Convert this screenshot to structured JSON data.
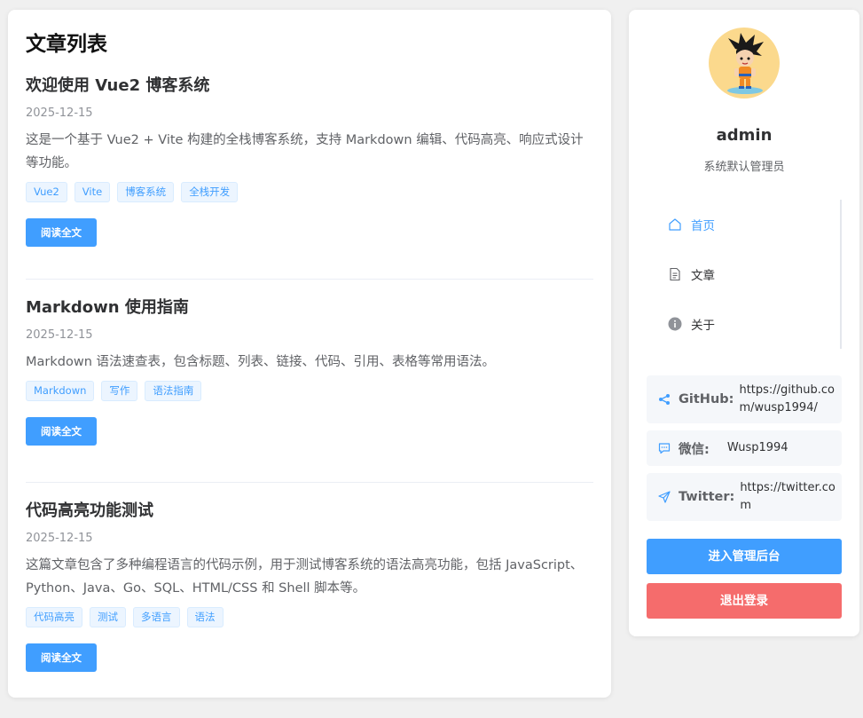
{
  "list": {
    "title": "文章列表",
    "read_more_label": "阅读全文",
    "articles": [
      {
        "title": "欢迎使用 Vue2 博客系统",
        "date": "2025-12-15",
        "summary": "这是一个基于 Vue2 + Vite 构建的全栈博客系统，支持 Markdown 编辑、代码高亮、响应式设计等功能。",
        "tags": [
          "Vue2",
          "Vite",
          "博客系统",
          "全栈开发"
        ]
      },
      {
        "title": "Markdown 使用指南",
        "date": "2025-12-15",
        "summary": "Markdown 语法速查表，包含标题、列表、链接、代码、引用、表格等常用语法。",
        "tags": [
          "Markdown",
          "写作",
          "语法指南"
        ]
      },
      {
        "title": "代码高亮功能测试",
        "date": "2025-12-15",
        "summary": "这篇文章包含了多种编程语言的代码示例，用于测试博客系统的语法高亮功能，包括 JavaScript、Python、Java、Go、SQL、HTML/CSS 和 Shell 脚本等。",
        "tags": [
          "代码高亮",
          "测试",
          "多语言",
          "语法"
        ]
      }
    ]
  },
  "sidebar": {
    "username": "admin",
    "description": "系统默认管理员",
    "nav": [
      {
        "label": "首页",
        "icon": "home-icon",
        "active": true
      },
      {
        "label": "文章",
        "icon": "document-icon",
        "active": false
      },
      {
        "label": "关于",
        "icon": "info-icon",
        "active": false
      }
    ],
    "social": {
      "github": {
        "label": "GitHub:",
        "value": "https://github.com/wusp1994/",
        "icon": "share-icon"
      },
      "wechat": {
        "label": "微信:",
        "value": "Wusp1994",
        "icon": "chat-icon"
      },
      "twitter": {
        "label": "Twitter:",
        "value": "https://twitter.com",
        "icon": "send-icon"
      }
    },
    "admin_button": "进入管理后台",
    "logout_button": "退出登录"
  },
  "colors": {
    "primary": "#409eff",
    "danger": "#f56c6c",
    "page_bg": "#f0f0f0",
    "tag_bg": "#ecf5ff"
  }
}
